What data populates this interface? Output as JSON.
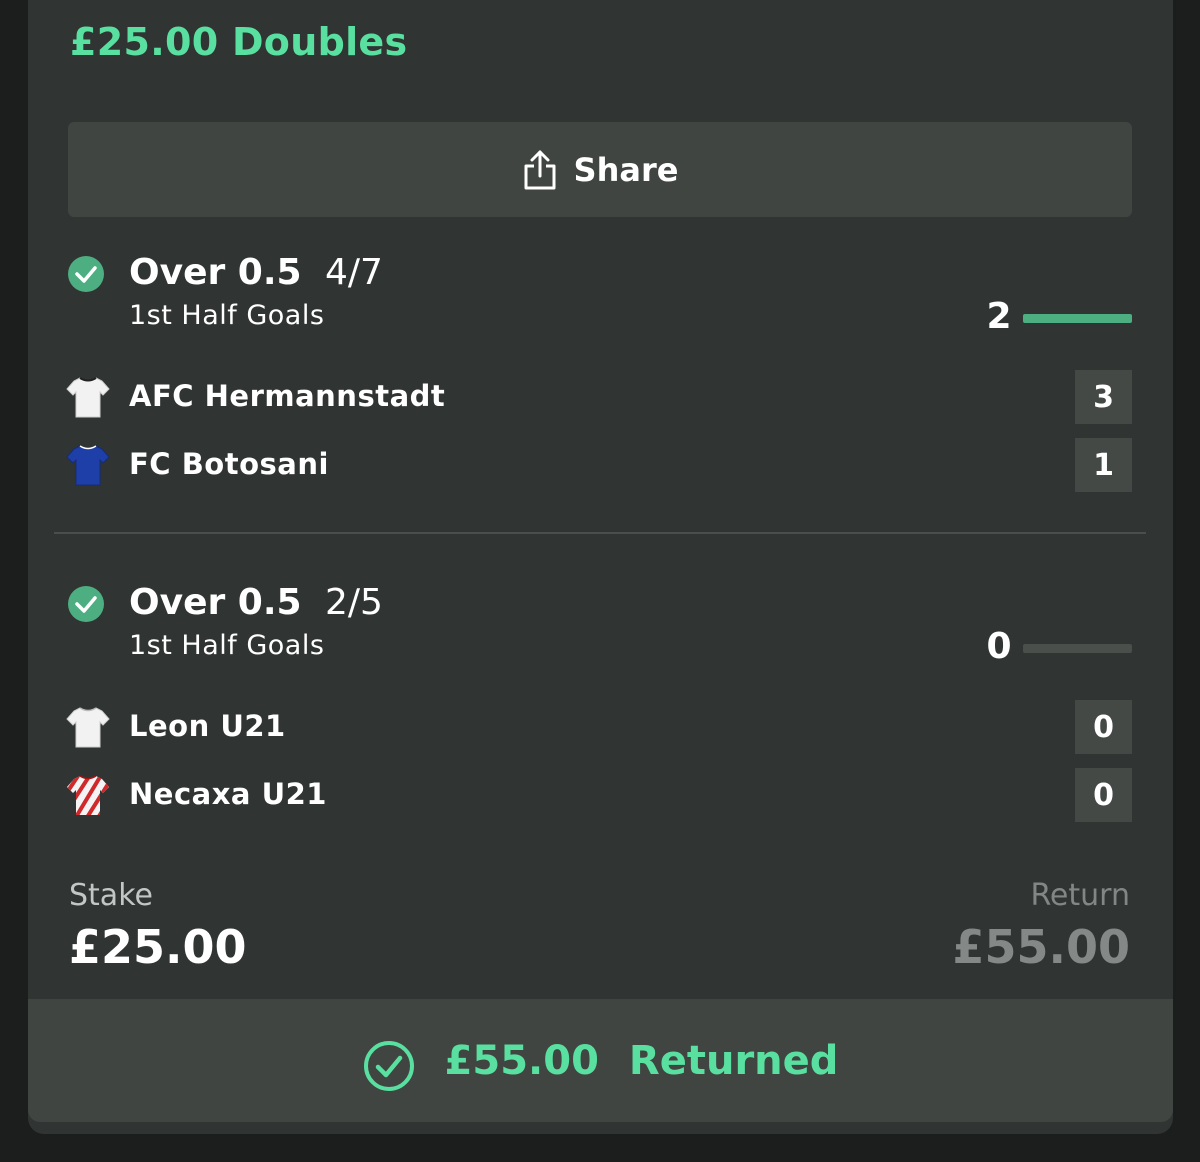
{
  "bet": {
    "title": "£25.00 Doubles",
    "share_label": "Share",
    "stake_label": "Stake",
    "stake_value": "£25.00",
    "return_label": "Return",
    "return_value": "£55.00",
    "footer_amount": "£55.00",
    "footer_status": "Returned"
  },
  "legs": [
    {
      "selection": "Over 0.5",
      "odds": "4/7",
      "market": "1st Half Goals",
      "progress_value": "2",
      "progress_fill": 1.0,
      "teams": [
        {
          "name": "AFC Hermannstadt",
          "score": "3",
          "shirt": "white-shirt-icon"
        },
        {
          "name": "FC Botosani",
          "score": "1",
          "shirt": "blue-shirt-icon"
        }
      ]
    },
    {
      "selection": "Over 0.5",
      "odds": "2/5",
      "market": "1st Half Goals",
      "progress_value": "0",
      "progress_fill": 0.0,
      "teams": [
        {
          "name": "Leon U21",
          "score": "0",
          "shirt": "white-shirt-icon"
        },
        {
          "name": "Necaxa U21",
          "score": "0",
          "shirt": "red-white-striped-shirt-icon"
        }
      ]
    }
  ],
  "colors": {
    "accent": "#59e0a0",
    "check": "#4dae81",
    "card": "#303432",
    "button": "#404542"
  }
}
